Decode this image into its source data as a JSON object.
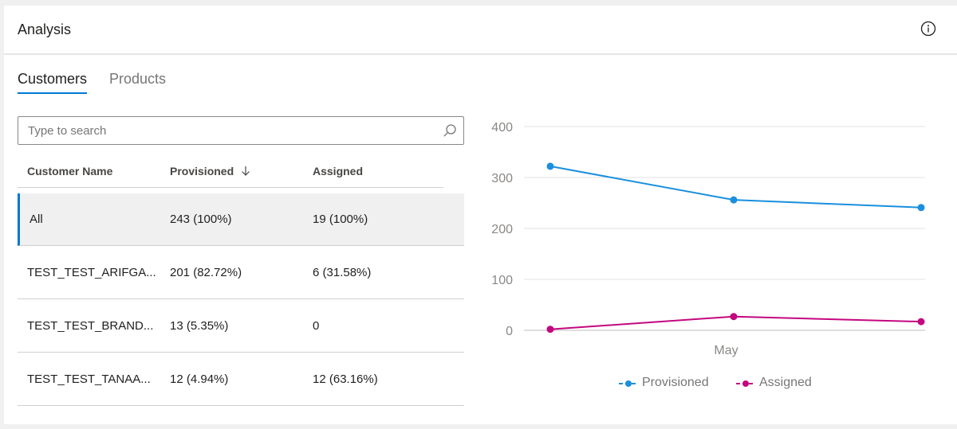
{
  "header": {
    "title": "Analysis",
    "info_icon": "info-icon"
  },
  "tabs": [
    {
      "label": "Customers",
      "active": true
    },
    {
      "label": "Products",
      "active": false
    }
  ],
  "search": {
    "placeholder": "Type to search",
    "value": ""
  },
  "table": {
    "columns": [
      {
        "label": "Customer Name"
      },
      {
        "label": "Provisioned",
        "sort": "descending"
      },
      {
        "label": "Assigned"
      }
    ],
    "rows": [
      {
        "name": "All",
        "provisioned": "243 (100%)",
        "assigned": "19 (100%)",
        "selected": true
      },
      {
        "name": "TEST_TEST_ARIFGA...",
        "provisioned": "201 (82.72%)",
        "assigned": "6 (31.58%)",
        "selected": false
      },
      {
        "name": "TEST_TEST_BRAND...",
        "provisioned": "13 (5.35%)",
        "assigned": "0",
        "selected": false
      },
      {
        "name": "TEST_TEST_TANAA...",
        "provisioned": "12 (4.94%)",
        "assigned": "12 (63.16%)",
        "selected": false
      }
    ]
  },
  "colors": {
    "accent": "#0078d4",
    "provisioned": "#1a8fdd",
    "assigned": "#c3077f"
  },
  "chart_data": {
    "type": "line",
    "x_label_center": "May",
    "yticks": [
      "0",
      "100",
      "200",
      "300",
      "400"
    ],
    "ylim": [
      0,
      400
    ],
    "grid": true,
    "legend_position": "bottom",
    "series": [
      {
        "name": "Provisioned",
        "values": [
          322,
          256,
          241
        ]
      },
      {
        "name": "Assigned",
        "values": [
          2,
          27,
          17
        ]
      }
    ]
  }
}
